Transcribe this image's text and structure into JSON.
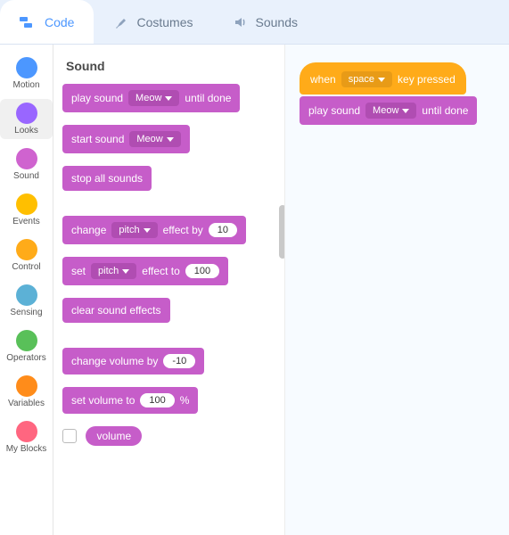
{
  "tabs": {
    "code": "Code",
    "costumes": "Costumes",
    "sounds": "Sounds"
  },
  "categories": [
    {
      "label": "Motion",
      "color": "#4c97ff"
    },
    {
      "label": "Looks",
      "color": "#9966ff"
    },
    {
      "label": "Sound",
      "color": "#cf63cf"
    },
    {
      "label": "Events",
      "color": "#ffbf00"
    },
    {
      "label": "Control",
      "color": "#ffab19"
    },
    {
      "label": "Sensing",
      "color": "#5cb1d6"
    },
    {
      "label": "Operators",
      "color": "#59c059"
    },
    {
      "label": "Variables",
      "color": "#ff8c1a"
    },
    {
      "label": "My Blocks",
      "color": "#ff6680"
    }
  ],
  "palette": {
    "title": "Sound",
    "b0": {
      "t1": "play sound",
      "dd": "Meow",
      "t2": "until done"
    },
    "b1": {
      "t1": "start sound",
      "dd": "Meow"
    },
    "b2": {
      "t1": "stop all sounds"
    },
    "b3": {
      "t1": "change",
      "dd": "pitch",
      "t2": "effect by",
      "val": "10"
    },
    "b4": {
      "t1": "set",
      "dd": "pitch",
      "t2": "effect to",
      "val": "100"
    },
    "b5": {
      "t1": "clear sound effects"
    },
    "b6": {
      "t1": "change volume by",
      "val": "-10"
    },
    "b7": {
      "t1": "set volume to",
      "val": "100",
      "t2": "%"
    },
    "b8": {
      "t1": "volume"
    }
  },
  "workspace": {
    "hat": {
      "t1": "when",
      "dd": "space",
      "t2": "key pressed"
    },
    "blk": {
      "t1": "play sound",
      "dd": "Meow",
      "t2": "until done"
    }
  }
}
